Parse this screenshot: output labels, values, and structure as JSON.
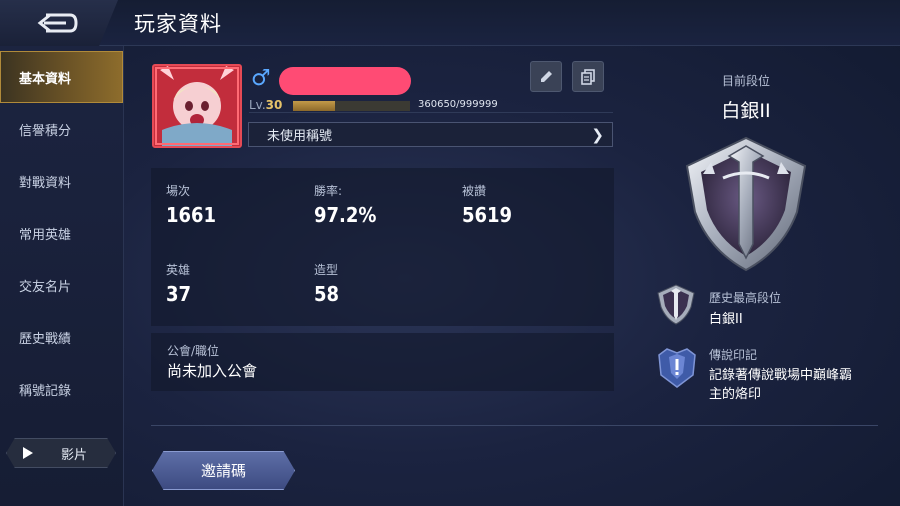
{
  "header": {
    "title": "玩家資料"
  },
  "sidebar": {
    "items": [
      {
        "label": "基本資料",
        "active": true
      },
      {
        "label": "信譽積分",
        "active": false
      },
      {
        "label": "對戰資料",
        "active": false
      },
      {
        "label": "常用英雄",
        "active": false
      },
      {
        "label": "交友名片",
        "active": false
      },
      {
        "label": "歷史戰績",
        "active": false
      },
      {
        "label": "稱號記錄",
        "active": false
      }
    ],
    "video_label": "影片"
  },
  "profile": {
    "gender_symbol": "♂",
    "level_prefix": "Lv.",
    "level": "30",
    "xp_text": "360650/999999",
    "xp_fraction": 0.36,
    "title_text": "未使用稱號"
  },
  "stats": {
    "matches": {
      "label": "場次",
      "value": "1661"
    },
    "win_rate": {
      "label": "勝率:",
      "value": "97.2%"
    },
    "likes": {
      "label": "被讚",
      "value": "5619"
    },
    "heroes": {
      "label": "英雄",
      "value": "37"
    },
    "skins": {
      "label": "造型",
      "value": "58"
    }
  },
  "guild": {
    "label": "公會/職位",
    "value": "尚未加入公會"
  },
  "invite_button": "邀請碼",
  "rank": {
    "current_label": "目前段位",
    "current_value": "白銀II",
    "history_label": "歷史最高段位",
    "history_value": "白銀II",
    "legend_label": "傳說印記",
    "legend_desc": "記錄著傳說戰場中巔峰霸主的烙印"
  },
  "colors": {
    "accent_gold": "#c29a48",
    "name_highlight": "#ff4b74",
    "gender_blue": "#5aa8ff"
  }
}
